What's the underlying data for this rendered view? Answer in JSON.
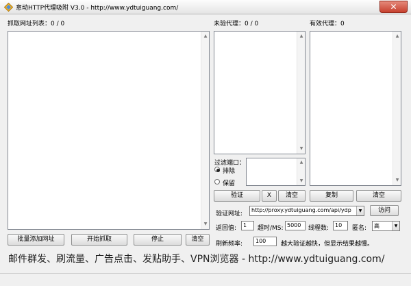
{
  "window": {
    "title": "意动HTTP代理吸附 V3.0 - http://www.ydtuiguang.com/",
    "close_glyph": "✕"
  },
  "panels": {
    "fetch_list_label": "抓取网址列表：0 / 0",
    "unverified_label": "未验代理：0 / 0",
    "valid_label": "有效代理：0"
  },
  "filter": {
    "label": "过滤端口：",
    "options": [
      "排除",
      "保留"
    ],
    "selected": "排除"
  },
  "buttons": {
    "verify": "验证",
    "x": "X",
    "clear_unverified": "清空",
    "copy": "复制",
    "clear_valid": "清空",
    "visit": "访问",
    "batch_add": "批量添加网址",
    "start_fetch": "开始抓取",
    "stop": "停止",
    "clear_urls": "清空"
  },
  "settings": {
    "verify_url_label": "验证网址:",
    "verify_url_value": "http://proxy.ydtuiguang.com/api/ydp",
    "return_label": "返回值:",
    "return_value": "1",
    "timeout_label": "超时/MS:",
    "timeout_value": "5000",
    "threads_label": "线程数:",
    "threads_value": "10",
    "anonymity_label": "匿名:",
    "anonymity_value": "高",
    "refresh_label": "刷新频率:",
    "refresh_value": "100",
    "refresh_hint": "越大验证越快，但显示结果越慢。"
  },
  "promo": "邮件群发、刷流量、广告点击、发贴助手、VPN浏览器 - http://www.ydtuiguang.com/"
}
